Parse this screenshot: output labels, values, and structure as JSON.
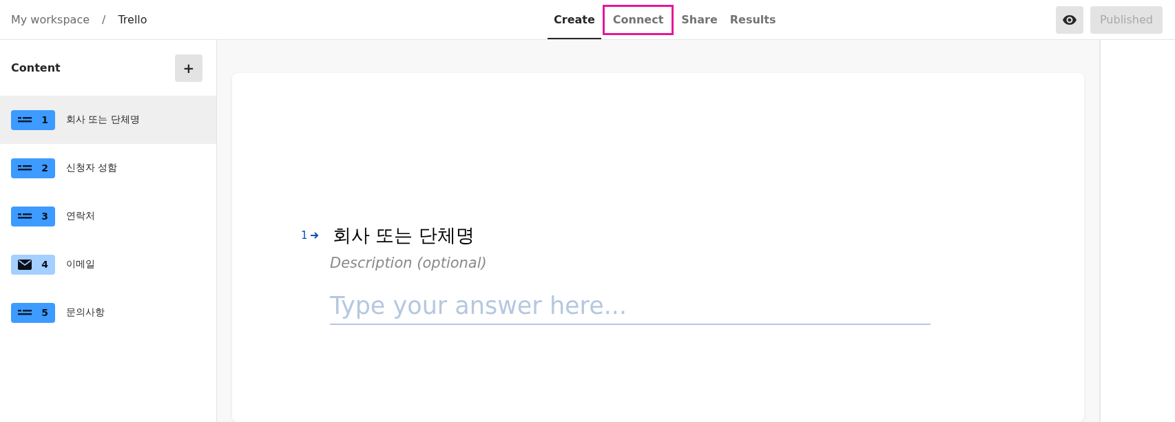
{
  "breadcrumb": {
    "workspace": "My workspace",
    "separator": "/",
    "form": "Trello"
  },
  "tabs": [
    {
      "label": "Create",
      "selected": true,
      "highlighted": false
    },
    {
      "label": "Connect",
      "selected": false,
      "highlighted": true
    },
    {
      "label": "Share",
      "selected": false,
      "highlighted": false
    },
    {
      "label": "Results",
      "selected": false,
      "highlighted": false
    }
  ],
  "publish_button": {
    "label": "Published",
    "disabled": true
  },
  "sidebar": {
    "title": "Content",
    "add_button": "+",
    "items": [
      {
        "kind": "text",
        "number": "1",
        "label": "회사 또는 단체명",
        "selected": true
      },
      {
        "kind": "text",
        "number": "2",
        "label": "신청자 성함",
        "selected": false
      },
      {
        "kind": "text",
        "number": "3",
        "label": "연락처",
        "selected": false
      },
      {
        "kind": "email",
        "number": "4",
        "label": "이메일",
        "selected": false
      },
      {
        "kind": "text",
        "number": "5",
        "label": "문의사항",
        "selected": false
      }
    ]
  },
  "question": {
    "number": "1",
    "title": "회사 또는 단체명",
    "description": "Description (optional)",
    "placeholder": "Type your answer here..."
  }
}
